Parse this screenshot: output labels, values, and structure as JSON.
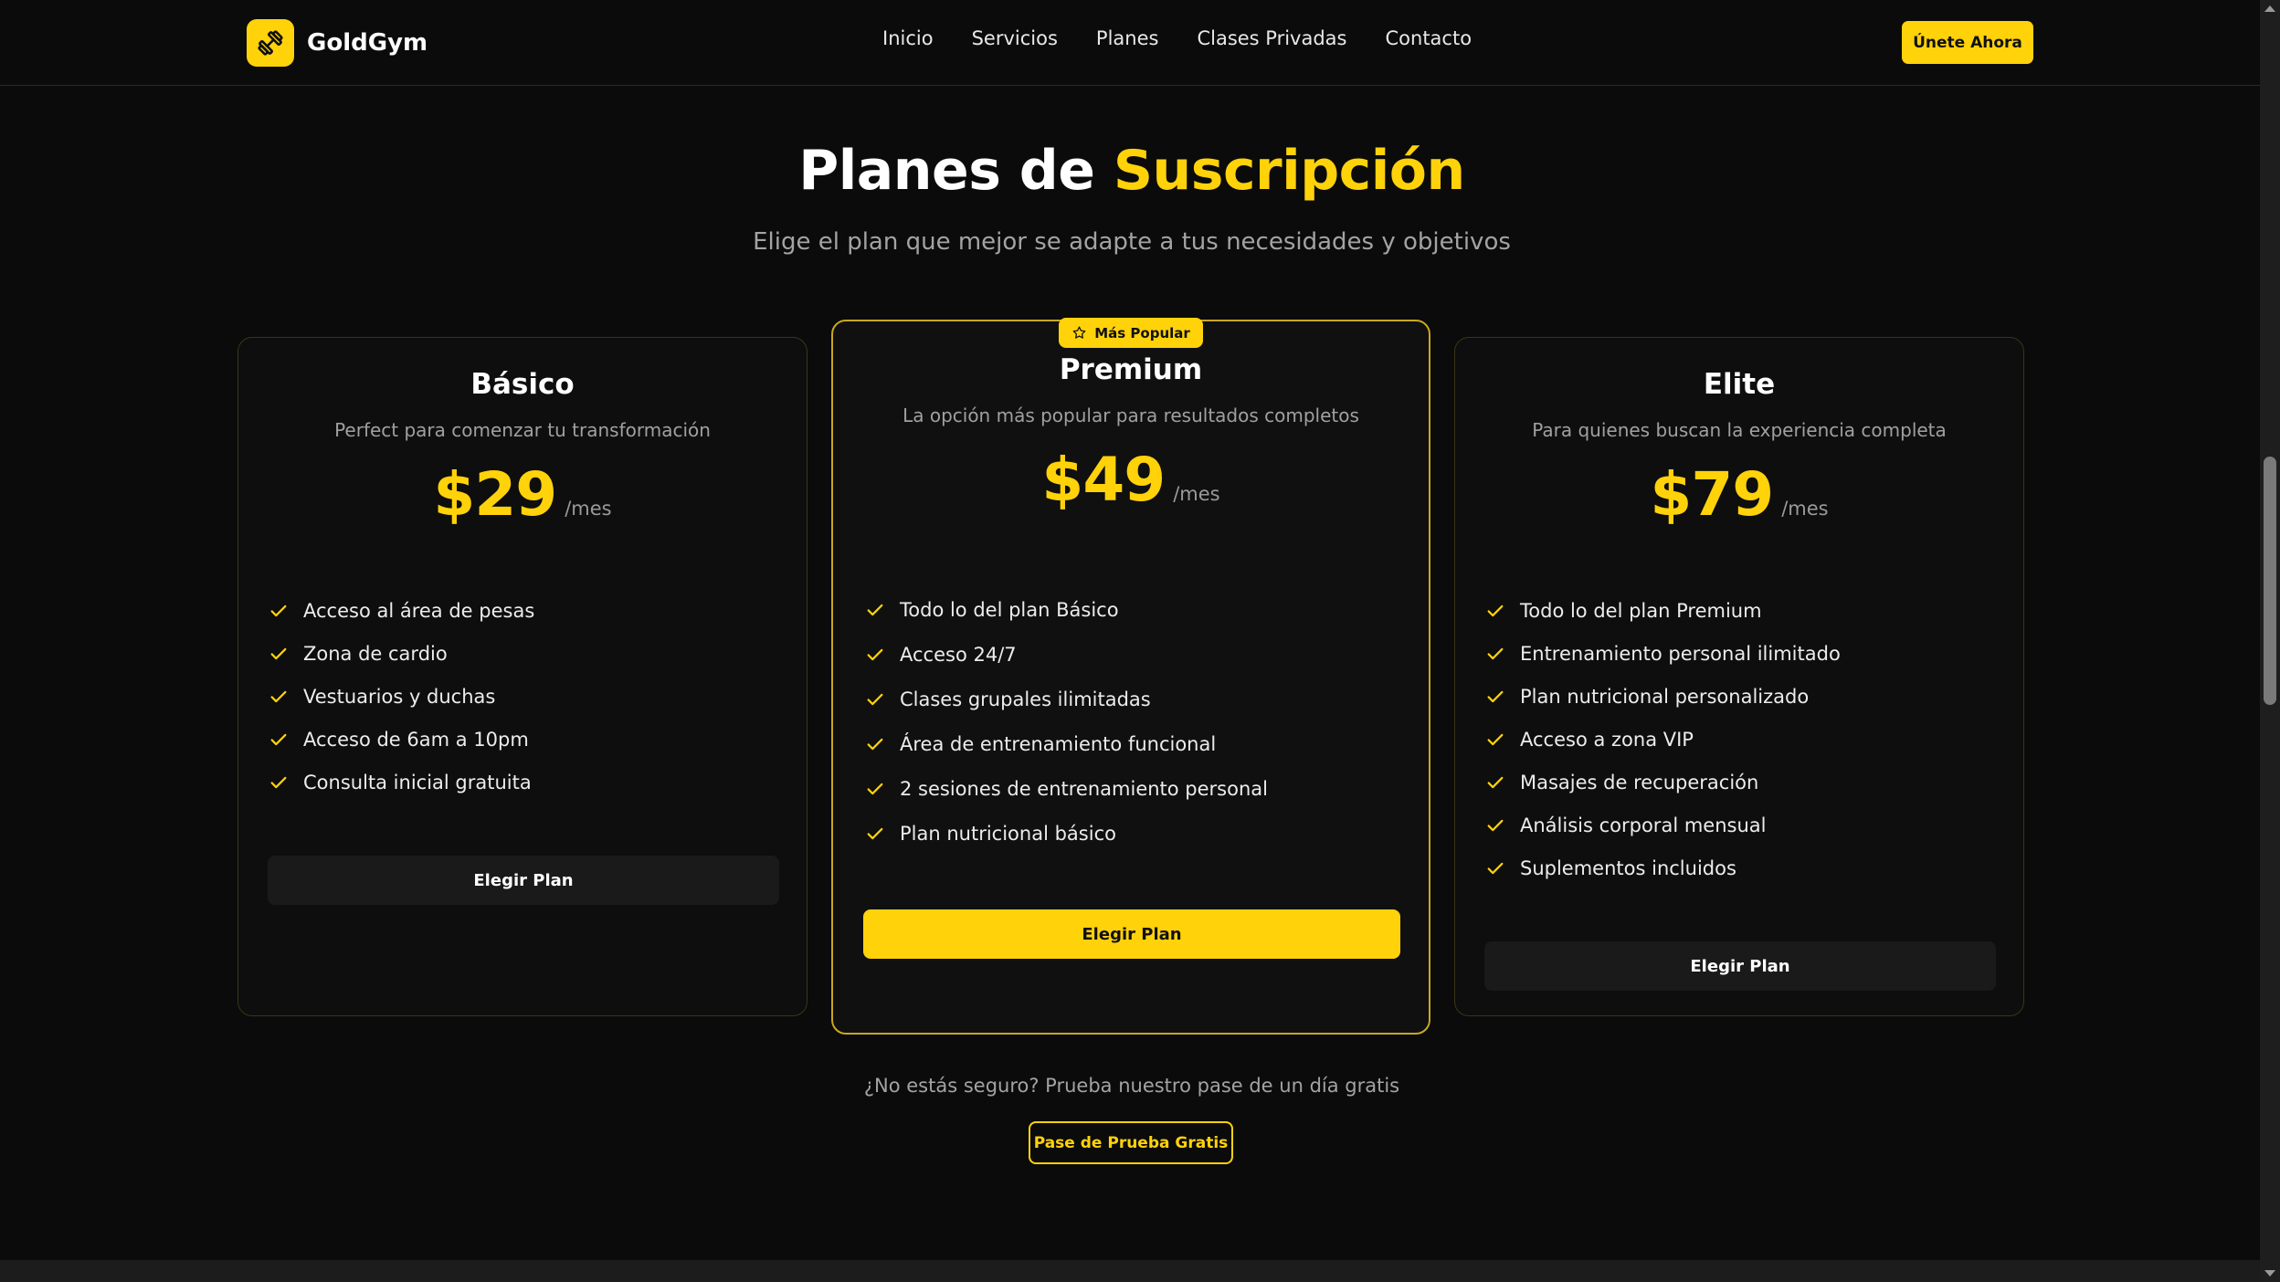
{
  "nav": {
    "logo_text": "GoldGym",
    "links": [
      "Inicio",
      "Servicios",
      "Planes",
      "Clases Privadas",
      "Contacto"
    ],
    "cta_label": "Únete Ahora"
  },
  "header": {
    "title_prefix": "Planes de ",
    "title_accent": "Suscripción",
    "subtitle": "Elige el plan que mejor se adapte a tus necesidades y objetivos"
  },
  "plans": [
    {
      "name": "Básico",
      "description": "Perfect para comenzar tu transformación",
      "price": "$29",
      "period": "/mes",
      "features": [
        "Acceso al área de pesas",
        "Zona de cardio",
        "Vestuarios y duchas",
        "Acceso de 6am a 10pm",
        "Consulta inicial gratuita"
      ],
      "button_label": "Elegir Plan"
    },
    {
      "name": "Premium",
      "badge": "Más Popular",
      "description": "La opción más popular para resultados completos",
      "price": "$49",
      "period": "/mes",
      "features": [
        "Todo lo del plan Básico",
        "Acceso 24/7",
        "Clases grupales ilimitadas",
        "Área de entrenamiento funcional",
        "2 sesiones de entrenamiento personal",
        "Plan nutricional básico"
      ],
      "button_label": "Elegir Plan"
    },
    {
      "name": "Elite",
      "description": "Para quienes buscan la experiencia completa",
      "price": "$79",
      "period": "/mes",
      "features": [
        "Todo lo del plan Premium",
        "Entrenamiento personal ilimitado",
        "Plan nutricional personalizado",
        "Acceso a zona VIP",
        "Masajes de recuperación",
        "Análisis corporal mensual",
        "Suplementos incluidos"
      ],
      "button_label": "Elegir Plan"
    }
  ],
  "trial": {
    "text": "¿No estás seguro? Prueba nuestro pase de un día gratis",
    "button_label": "Pase de Prueba Gratis"
  },
  "colors": {
    "accent": "#ffd20a",
    "background": "#0b0b0b",
    "card_border": "#3a3518"
  },
  "icons": {
    "logo": "dumbbell-icon",
    "feature": "check-icon",
    "badge": "star-icon"
  }
}
